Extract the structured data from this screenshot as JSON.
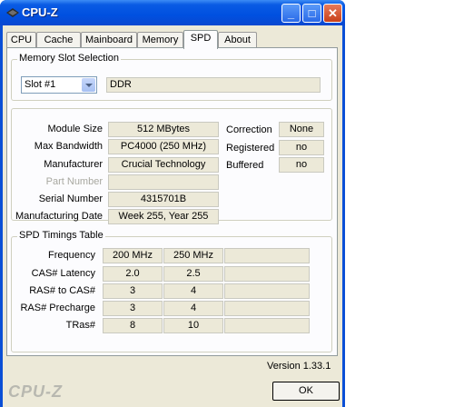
{
  "window": {
    "title": "CPU-Z"
  },
  "title_buttons": {
    "minimize": "_",
    "maximize": "□",
    "close": "✕"
  },
  "tabs": [
    {
      "label": "CPU"
    },
    {
      "label": "Cache"
    },
    {
      "label": "Mainboard"
    },
    {
      "label": "Memory"
    },
    {
      "label": "SPD",
      "active": true
    },
    {
      "label": "About"
    }
  ],
  "slot_selection": {
    "title": "Memory Slot Selection",
    "slot_value": "Slot #1",
    "memory_type": "DDR"
  },
  "module": {
    "labels": {
      "size": "Module Size",
      "bandwidth": "Max Bandwidth",
      "manufacturer": "Manufacturer",
      "part_number": "Part Number",
      "serial": "Serial Number",
      "mfg_date": "Manufacturing Date",
      "correction": "Correction",
      "registered": "Registered",
      "buffered": "Buffered"
    },
    "values": {
      "size": "512 MBytes",
      "bandwidth": "PC4000 (250 MHz)",
      "manufacturer": "Crucial Technology",
      "part_number": "",
      "serial": "4315701B",
      "mfg_date": "Week 255, Year 255",
      "correction": "None",
      "registered": "no",
      "buffered": "no"
    }
  },
  "timings": {
    "title": "SPD Timings Table",
    "rows": [
      {
        "label": "Frequency",
        "values": [
          "200 MHz",
          "250 MHz",
          ""
        ]
      },
      {
        "label": "CAS# Latency",
        "values": [
          "2.0",
          "2.5",
          ""
        ]
      },
      {
        "label": "RAS# to CAS#",
        "values": [
          "3",
          "4",
          ""
        ]
      },
      {
        "label": "RAS# Precharge",
        "values": [
          "3",
          "4",
          ""
        ]
      },
      {
        "label": "TRas#",
        "values": [
          "8",
          "10",
          ""
        ]
      }
    ]
  },
  "footer": {
    "version": "Version 1.33.1",
    "brand": "CPU-Z",
    "ok_label": "OK"
  }
}
